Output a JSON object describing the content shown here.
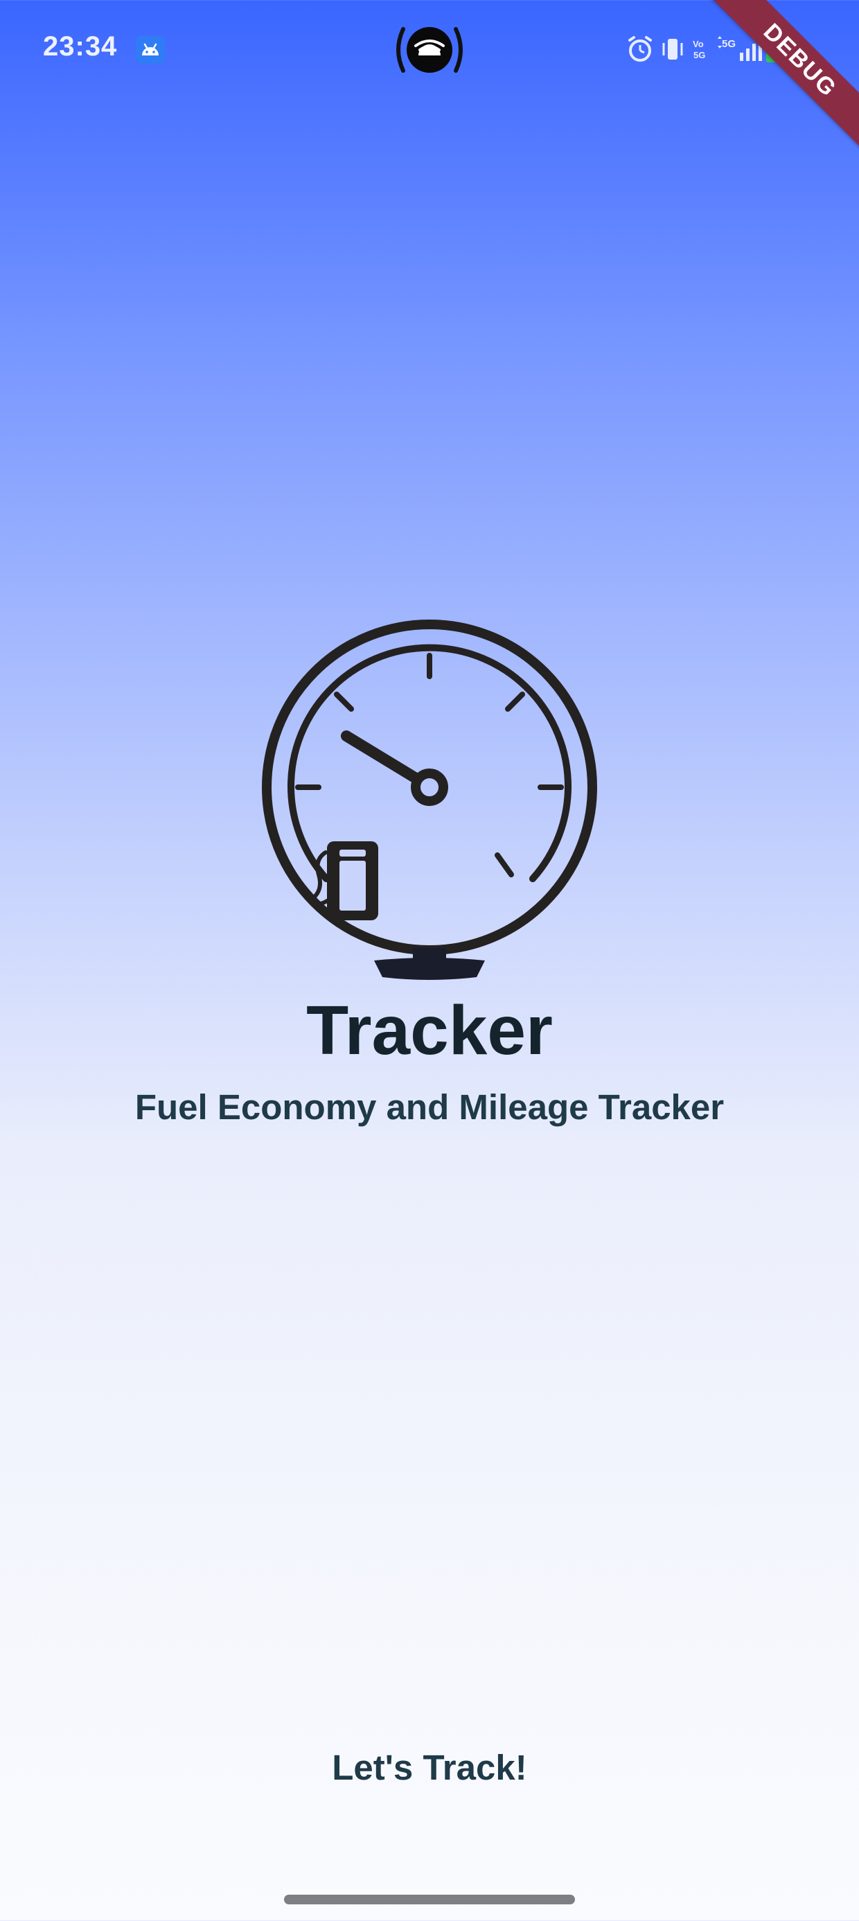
{
  "status_bar": {
    "time": "23:34",
    "icons": [
      "android-icon",
      "hotspot-icon",
      "alarm-icon",
      "vibrate-icon",
      "volte-icon",
      "5g-icon",
      "signal-icon",
      "battery-icon"
    ]
  },
  "debug_banner": {
    "label": "DEBUG",
    "color": "#8b2c45"
  },
  "splash": {
    "logo": "fuel-gauge-icon",
    "title": "Tracker",
    "subtitle": "Fuel Economy and Mileage Tracker",
    "cta_label": "Let's Track!"
  },
  "colors": {
    "gradient_top": "#3a66ff",
    "gradient_bottom": "#fafbfe",
    "title": "#15232c",
    "text": "#1f3a48"
  }
}
